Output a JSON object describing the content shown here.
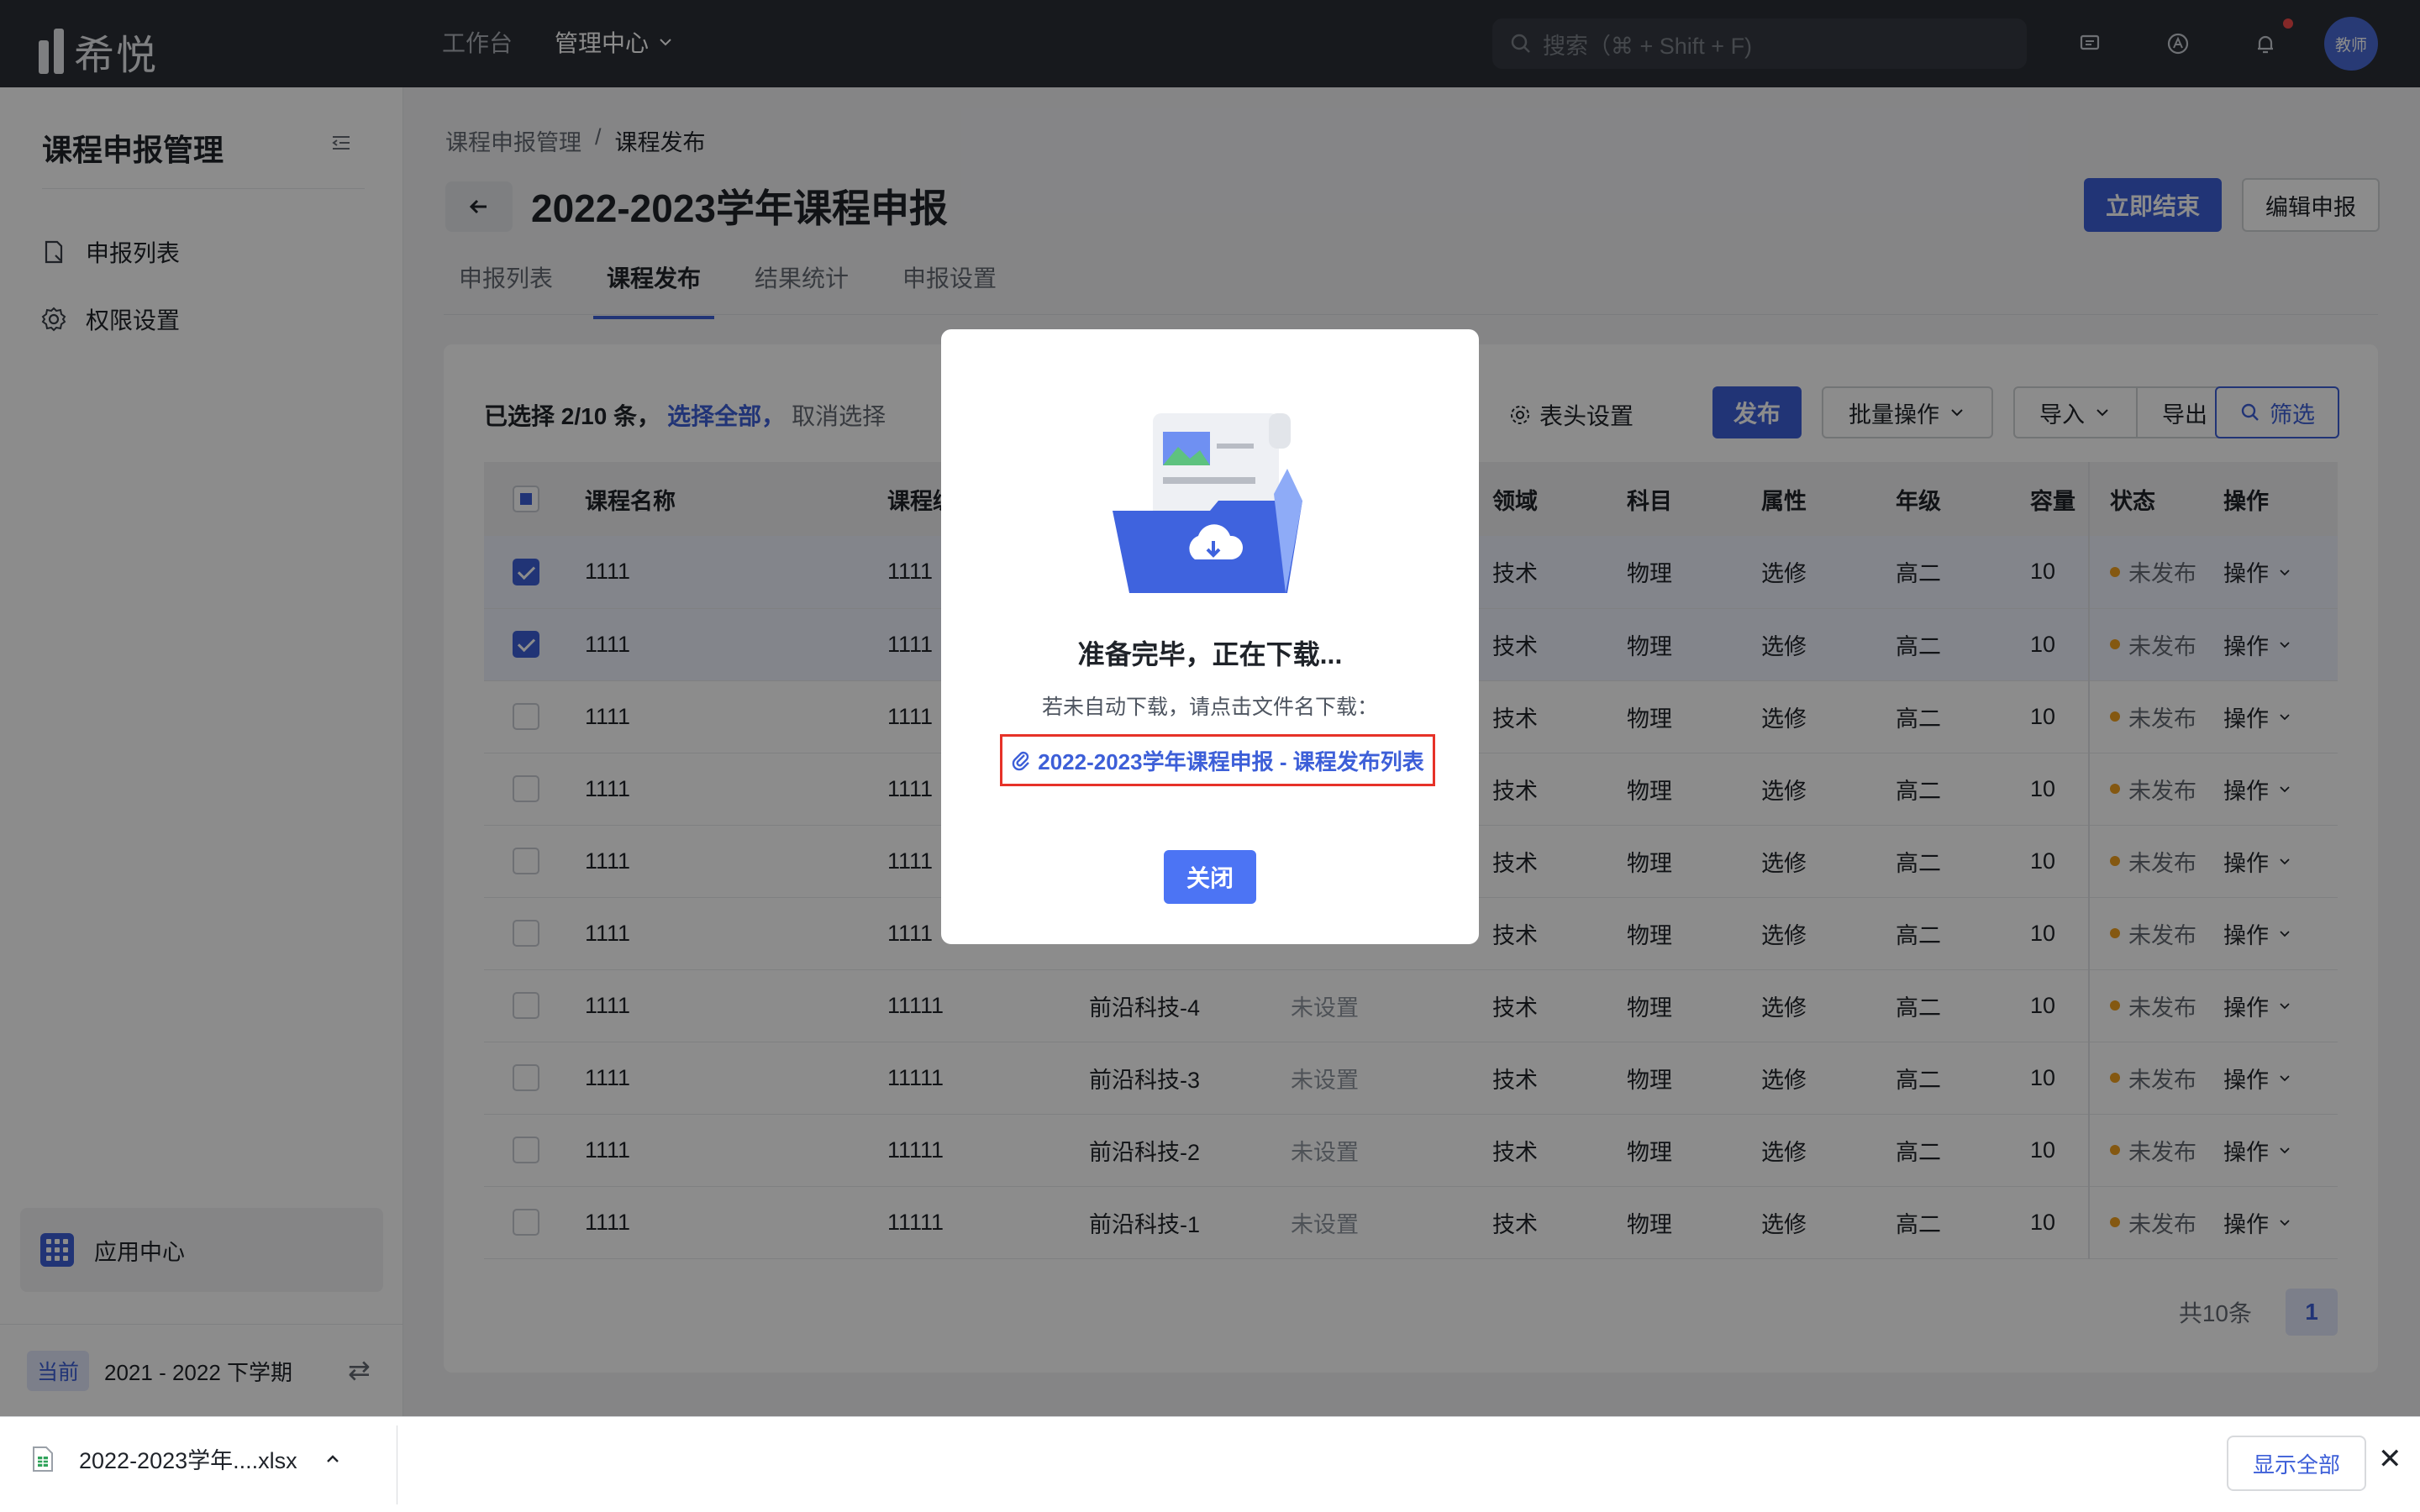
{
  "app": {
    "logo_text": "希悦",
    "avatar_text": "教师"
  },
  "topnav": {
    "items": [
      "工作台",
      "管理中心"
    ]
  },
  "search": {
    "placeholder": "搜索（⌘ + Shift + F)"
  },
  "sidebar": {
    "title": "课程申报管理",
    "items": [
      {
        "label": "申报列表",
        "icon": "file-icon"
      },
      {
        "label": "权限设置",
        "icon": "gear-icon"
      }
    ],
    "app_center": "应用中心",
    "term_tag": "当前",
    "term": "2021 - 2022 下学期"
  },
  "breadcrumb": [
    "课程申报管理",
    "/",
    "课程发布"
  ],
  "page": {
    "title": "2022-2023学年课程申报",
    "btn_end": "立即结束",
    "btn_edit": "编辑申报"
  },
  "tabs": [
    "申报列表",
    "课程发布",
    "结果统计",
    "申报设置"
  ],
  "toolbar": {
    "selected_text": "已选择 2/10 条，",
    "select_all": "选择全部，",
    "cancel_select": "取消选择",
    "header_settings": "表头设置",
    "publish": "发布",
    "batch": "批量操作",
    "import": "导入",
    "export": "导出",
    "filter": "筛选"
  },
  "table": {
    "headers": [
      "课程名称",
      "课程编",
      "",
      "",
      "领域",
      "科目",
      "属性",
      "年级",
      "容量",
      "状态",
      "操作"
    ],
    "rows": [
      {
        "selected": true,
        "name": "1111",
        "code": "1111",
        "tag": "",
        "teacher": "",
        "field": "技术",
        "subject": "物理",
        "attr": "选修",
        "grade": "高二",
        "cap": "10",
        "status": "未发布",
        "op": "操作"
      },
      {
        "selected": true,
        "name": "1111",
        "code": "1111",
        "tag": "",
        "teacher": "",
        "field": "技术",
        "subject": "物理",
        "attr": "选修",
        "grade": "高二",
        "cap": "10",
        "status": "未发布",
        "op": "操作"
      },
      {
        "selected": false,
        "name": "1111",
        "code": "1111",
        "tag": "",
        "teacher": "",
        "field": "技术",
        "subject": "物理",
        "attr": "选修",
        "grade": "高二",
        "cap": "10",
        "status": "未发布",
        "op": "操作"
      },
      {
        "selected": false,
        "name": "1111",
        "code": "1111",
        "tag": "",
        "teacher": "",
        "field": "技术",
        "subject": "物理",
        "attr": "选修",
        "grade": "高二",
        "cap": "10",
        "status": "未发布",
        "op": "操作"
      },
      {
        "selected": false,
        "name": "1111",
        "code": "1111",
        "tag": "",
        "teacher": "",
        "field": "技术",
        "subject": "物理",
        "attr": "选修",
        "grade": "高二",
        "cap": "10",
        "status": "未发布",
        "op": "操作"
      },
      {
        "selected": false,
        "name": "1111",
        "code": "1111",
        "tag": "",
        "teacher": "",
        "field": "技术",
        "subject": "物理",
        "attr": "选修",
        "grade": "高二",
        "cap": "10",
        "status": "未发布",
        "op": "操作"
      },
      {
        "selected": false,
        "name": "1111",
        "code": "11111",
        "tag": "前沿科技-4",
        "teacher": "未设置",
        "field": "技术",
        "subject": "物理",
        "attr": "选修",
        "grade": "高二",
        "cap": "10",
        "status": "未发布",
        "op": "操作"
      },
      {
        "selected": false,
        "name": "1111",
        "code": "11111",
        "tag": "前沿科技-3",
        "teacher": "未设置",
        "field": "技术",
        "subject": "物理",
        "attr": "选修",
        "grade": "高二",
        "cap": "10",
        "status": "未发布",
        "op": "操作"
      },
      {
        "selected": false,
        "name": "1111",
        "code": "11111",
        "tag": "前沿科技-2",
        "teacher": "未设置",
        "field": "技术",
        "subject": "物理",
        "attr": "选修",
        "grade": "高二",
        "cap": "10",
        "status": "未发布",
        "op": "操作"
      },
      {
        "selected": false,
        "name": "1111",
        "code": "11111",
        "tag": "前沿科技-1",
        "teacher": "未设置",
        "field": "技术",
        "subject": "物理",
        "attr": "选修",
        "grade": "高二",
        "cap": "10",
        "status": "未发布",
        "op": "操作"
      }
    ]
  },
  "pager": {
    "total": "共10条",
    "current": "1"
  },
  "modal": {
    "title": "准备完毕，正在下载...",
    "subtitle": "若未自动下载，请点击文件名下载：",
    "link": "2022-2023学年课程申报 - 课程发布列表",
    "close": "关闭"
  },
  "download_bar": {
    "file": "2022-2023学年....xlsx",
    "show_all": "显示全部"
  },
  "colors": {
    "accent": "#3d5fd8",
    "status_dot": "#f0a020",
    "highlight_border": "#e63228"
  }
}
